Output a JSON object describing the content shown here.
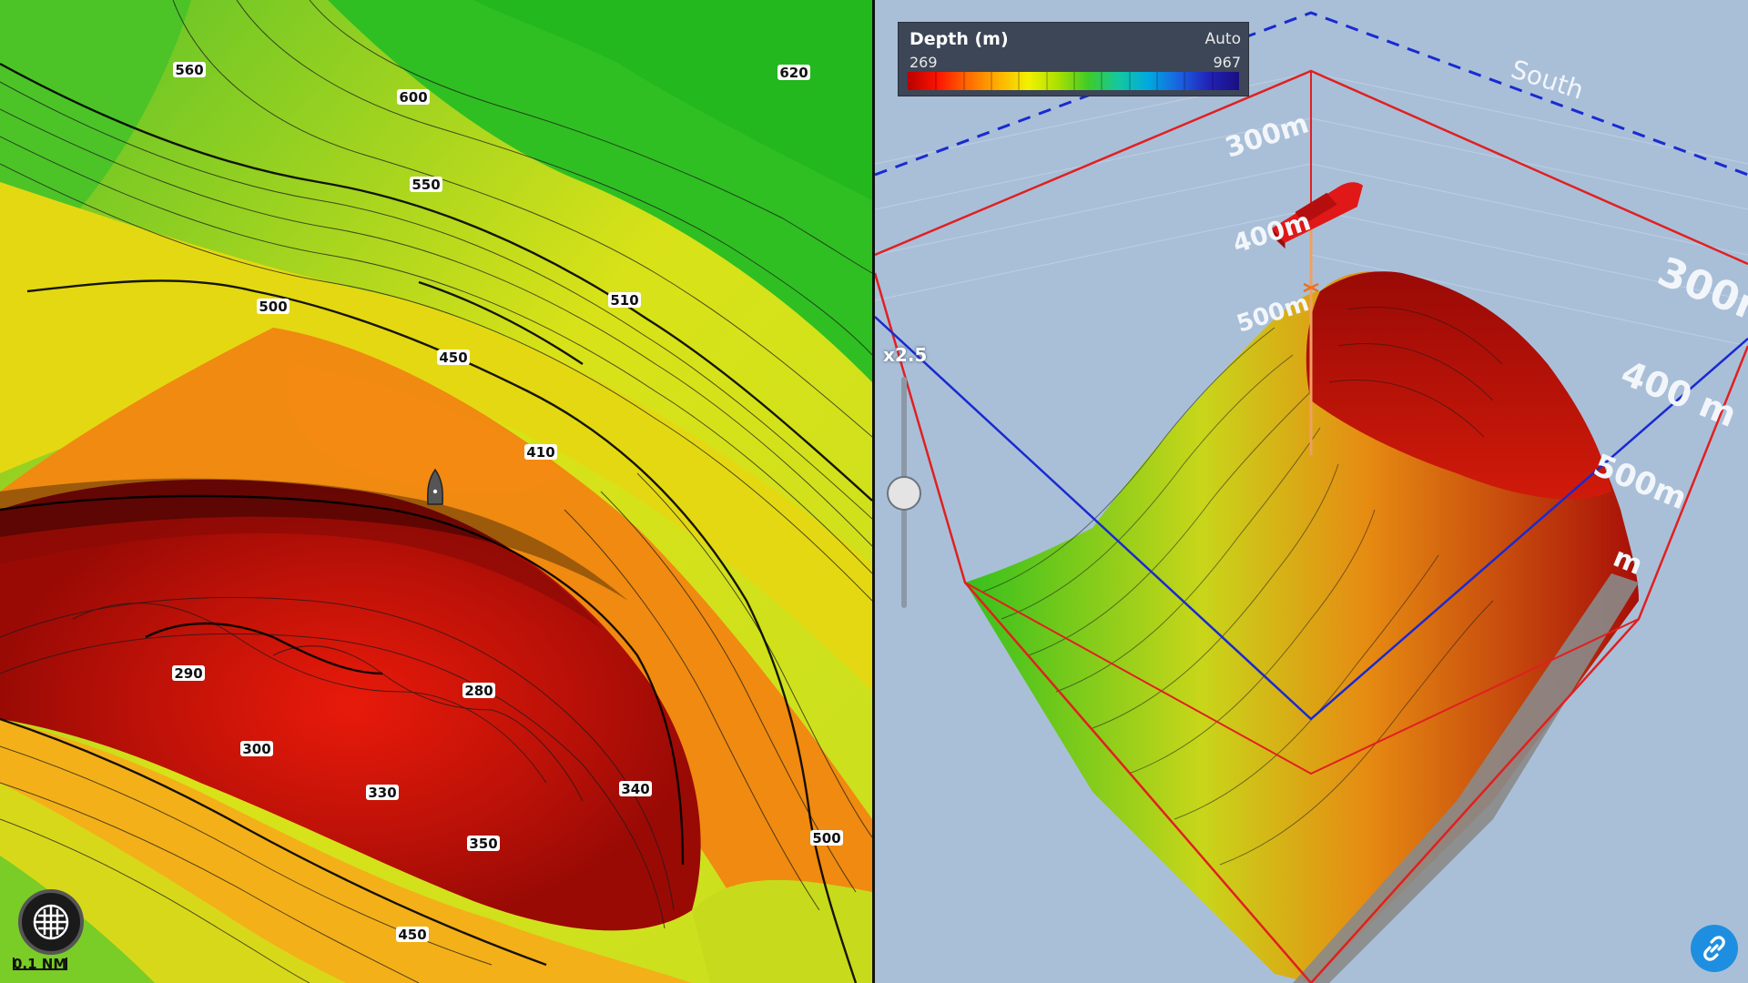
{
  "chart_map": {
    "contour_labels": [
      "560",
      "600",
      "620",
      "550",
      "500",
      "510",
      "450",
      "410",
      "290",
      "280",
      "300",
      "330",
      "340",
      "350",
      "500",
      "450"
    ]
  },
  "legend": {
    "title": "Depth (m)",
    "mode": "Auto",
    "min": "269",
    "max": "967"
  },
  "view3d": {
    "exaggeration": "x2.5",
    "compass": "South",
    "depth_labels_back": [
      "300m",
      "400m",
      "500m"
    ],
    "depth_labels_right": [
      "300m",
      "400 m",
      "500m",
      "m"
    ]
  },
  "controls": {
    "scale_label": "0.1 NM"
  },
  "colors": {
    "frame": "#e02020",
    "blue_outline": "#1a2ad0",
    "background": "#a9bfd8",
    "boat_3d": "#e01818"
  },
  "icons": {
    "grid_button": "grid-icon",
    "link_button": "link-icon",
    "own_vessel": "boat-icon"
  }
}
